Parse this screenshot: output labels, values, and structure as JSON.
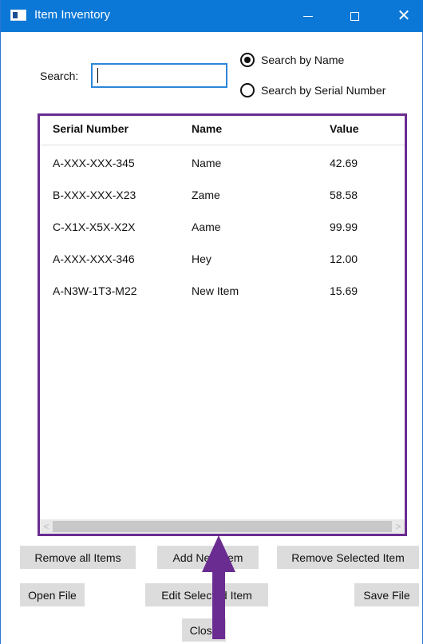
{
  "window": {
    "title": "Item Inventory"
  },
  "search": {
    "label": "Search:",
    "value": ""
  },
  "radio": {
    "by_name": {
      "label": "Search by Name",
      "checked": true
    },
    "by_serial": {
      "label": "Search by Serial Number",
      "checked": false
    }
  },
  "table": {
    "headers": [
      "Serial Number",
      "Name",
      "Value"
    ],
    "rows": [
      [
        "A-XXX-XXX-345",
        "Name",
        "42.69"
      ],
      [
        "B-XXX-XXX-X23",
        "Zame",
        "58.58"
      ],
      [
        "C-X1X-X5X-X2X",
        "Aame",
        "99.99"
      ],
      [
        "A-XXX-XXX-346",
        "Hey",
        "12.00"
      ],
      [
        "A-N3W-1T3-M22",
        "New Item",
        "15.69"
      ]
    ]
  },
  "buttons": {
    "remove_all": "Remove all Items",
    "add": "Add New Item",
    "remove_selected": "Remove Selected Item",
    "open": "Open File",
    "edit": "Edit Selected Item",
    "save": "Save File",
    "close": "Close"
  },
  "colors": {
    "titlebar": "#0b78d7",
    "highlight_border": "#6a2c91",
    "arrow": "#6a2c91"
  }
}
